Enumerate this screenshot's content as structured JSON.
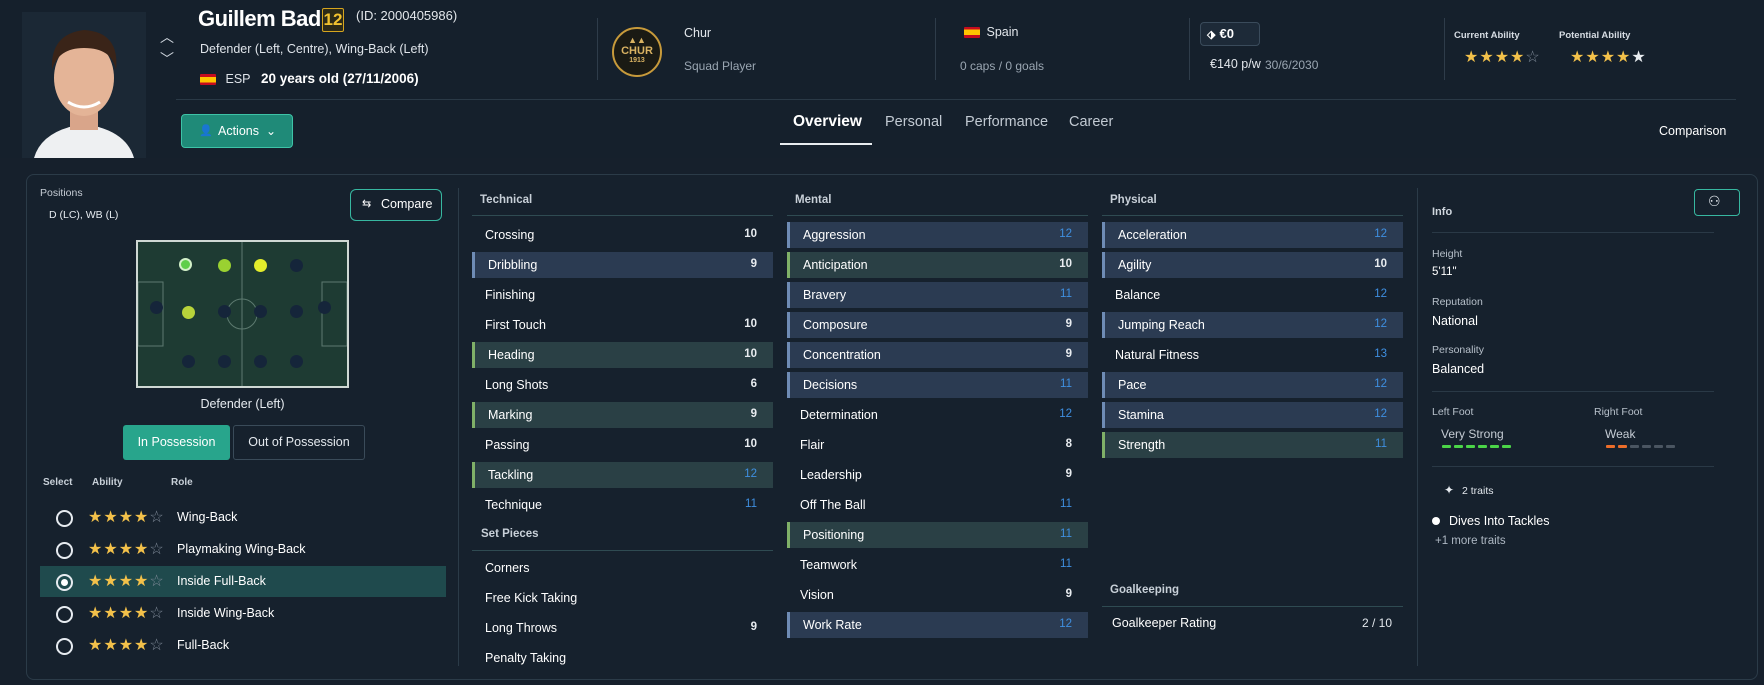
{
  "player": {
    "name": "Guillem Badia",
    "number": "12",
    "id": "(ID: 2000405986)",
    "positions_text": "Defender (Left, Centre), Wing-Back (Left)",
    "nation_code": "ESP",
    "age": "20 years old (27/11/2006)"
  },
  "club": {
    "name": "Chur",
    "role": "Squad Player",
    "logo_text": "CHUR",
    "logo_year": "1913"
  },
  "nation": {
    "name": "Spain",
    "caps": "0 caps / 0 goals"
  },
  "contract": {
    "value": "€0",
    "wage": "€140 p/w",
    "expiry": "30/6/2030"
  },
  "ability": {
    "current_label": "Current Ability",
    "current_stars": 3.5,
    "potential_label": "Potential Ability",
    "potential_stars": 4.5
  },
  "actions_label": "Actions",
  "tabs": [
    {
      "label": "Overview",
      "active": true
    },
    {
      "label": "Personal"
    },
    {
      "label": "Performance"
    },
    {
      "label": "Career"
    }
  ],
  "comparison_label": "Comparison",
  "positions_panel": {
    "title": "Positions",
    "value": "D (LC), WB (L)",
    "compare_label": "Compare",
    "selected_position": "Defender (Left)",
    "toggle_in": "In Possession",
    "toggle_out": "Out of Possession",
    "col_select": "Select",
    "col_ability": "Ability",
    "col_role": "Role",
    "roles": [
      {
        "name": "Wing-Back",
        "stars": 3.5,
        "selected": false
      },
      {
        "name": "Playmaking Wing-Back",
        "stars": 3.5,
        "selected": false
      },
      {
        "name": "Inside Full-Back",
        "stars": 3.5,
        "selected": true
      },
      {
        "name": "Inside Wing-Back",
        "stars": 3.5,
        "selected": false
      },
      {
        "name": "Full-Back",
        "stars": 3.5,
        "selected": false
      }
    ]
  },
  "technical": {
    "title": "Technical",
    "rows": [
      {
        "name": "Crossing",
        "value": "10",
        "hl": ""
      },
      {
        "name": "Dribbling",
        "value": "9",
        "hl": "b"
      },
      {
        "name": "Finishing",
        "value": "",
        "hl": ""
      },
      {
        "name": "First Touch",
        "value": "10",
        "hl": ""
      },
      {
        "name": "Heading",
        "value": "10",
        "hl": "g"
      },
      {
        "name": "Long Shots",
        "value": "6",
        "hl": ""
      },
      {
        "name": "Marking",
        "value": "9",
        "hl": "g"
      },
      {
        "name": "Passing",
        "value": "10",
        "hl": ""
      },
      {
        "name": "Tackling",
        "value": "12",
        "hl": "g",
        "blue": true
      },
      {
        "name": "Technique",
        "value": "11",
        "hl": "",
        "blue": true
      }
    ]
  },
  "set_pieces": {
    "title": "Set Pieces",
    "rows": [
      {
        "name": "Corners",
        "value": ""
      },
      {
        "name": "Free Kick Taking",
        "value": ""
      },
      {
        "name": "Long Throws",
        "value": "9"
      },
      {
        "name": "Penalty Taking",
        "value": ""
      }
    ]
  },
  "mental": {
    "title": "Mental",
    "rows": [
      {
        "name": "Aggression",
        "value": "12",
        "hl": "b",
        "blue": true
      },
      {
        "name": "Anticipation",
        "value": "10",
        "hl": "g"
      },
      {
        "name": "Bravery",
        "value": "11",
        "hl": "b",
        "blue": true
      },
      {
        "name": "Composure",
        "value": "9",
        "hl": "b"
      },
      {
        "name": "Concentration",
        "value": "9",
        "hl": "b"
      },
      {
        "name": "Decisions",
        "value": "11",
        "hl": "b",
        "blue": true
      },
      {
        "name": "Determination",
        "value": "12",
        "hl": "",
        "blue": true
      },
      {
        "name": "Flair",
        "value": "8",
        "hl": ""
      },
      {
        "name": "Leadership",
        "value": "9",
        "hl": ""
      },
      {
        "name": "Off The Ball",
        "value": "11",
        "hl": "",
        "blue": true
      },
      {
        "name": "Positioning",
        "value": "11",
        "hl": "g",
        "blue": true
      },
      {
        "name": "Teamwork",
        "value": "11",
        "hl": "",
        "blue": true
      },
      {
        "name": "Vision",
        "value": "9",
        "hl": ""
      },
      {
        "name": "Work Rate",
        "value": "12",
        "hl": "b",
        "blue": true
      }
    ]
  },
  "physical": {
    "title": "Physical",
    "rows": [
      {
        "name": "Acceleration",
        "value": "12",
        "hl": "b",
        "blue": true
      },
      {
        "name": "Agility",
        "value": "10",
        "hl": "b"
      },
      {
        "name": "Balance",
        "value": "12",
        "hl": "",
        "blue": true
      },
      {
        "name": "Jumping Reach",
        "value": "12",
        "hl": "b",
        "blue": true
      },
      {
        "name": "Natural Fitness",
        "value": "13",
        "hl": "",
        "blue": true
      },
      {
        "name": "Pace",
        "value": "12",
        "hl": "b",
        "blue": true
      },
      {
        "name": "Stamina",
        "value": "12",
        "hl": "b",
        "blue": true
      },
      {
        "name": "Strength",
        "value": "11",
        "hl": "g",
        "blue": true
      }
    ]
  },
  "goalkeeping": {
    "title": "Goalkeeping",
    "label": "Goalkeeper Rating",
    "value": "2 / 10"
  },
  "info": {
    "title": "Info",
    "height_label": "Height",
    "height": "5'11\"",
    "reputation_label": "Reputation",
    "reputation": "National",
    "personality_label": "Personality",
    "personality": "Balanced",
    "left_foot_label": "Left Foot",
    "left_foot": "Very Strong",
    "left_foot_level": 6,
    "right_foot_label": "Right Foot",
    "right_foot": "Weak",
    "right_foot_level": 2,
    "traits_count": "2 traits",
    "trait": "Dives Into Tackles",
    "more_traits": "+1 more traits"
  }
}
